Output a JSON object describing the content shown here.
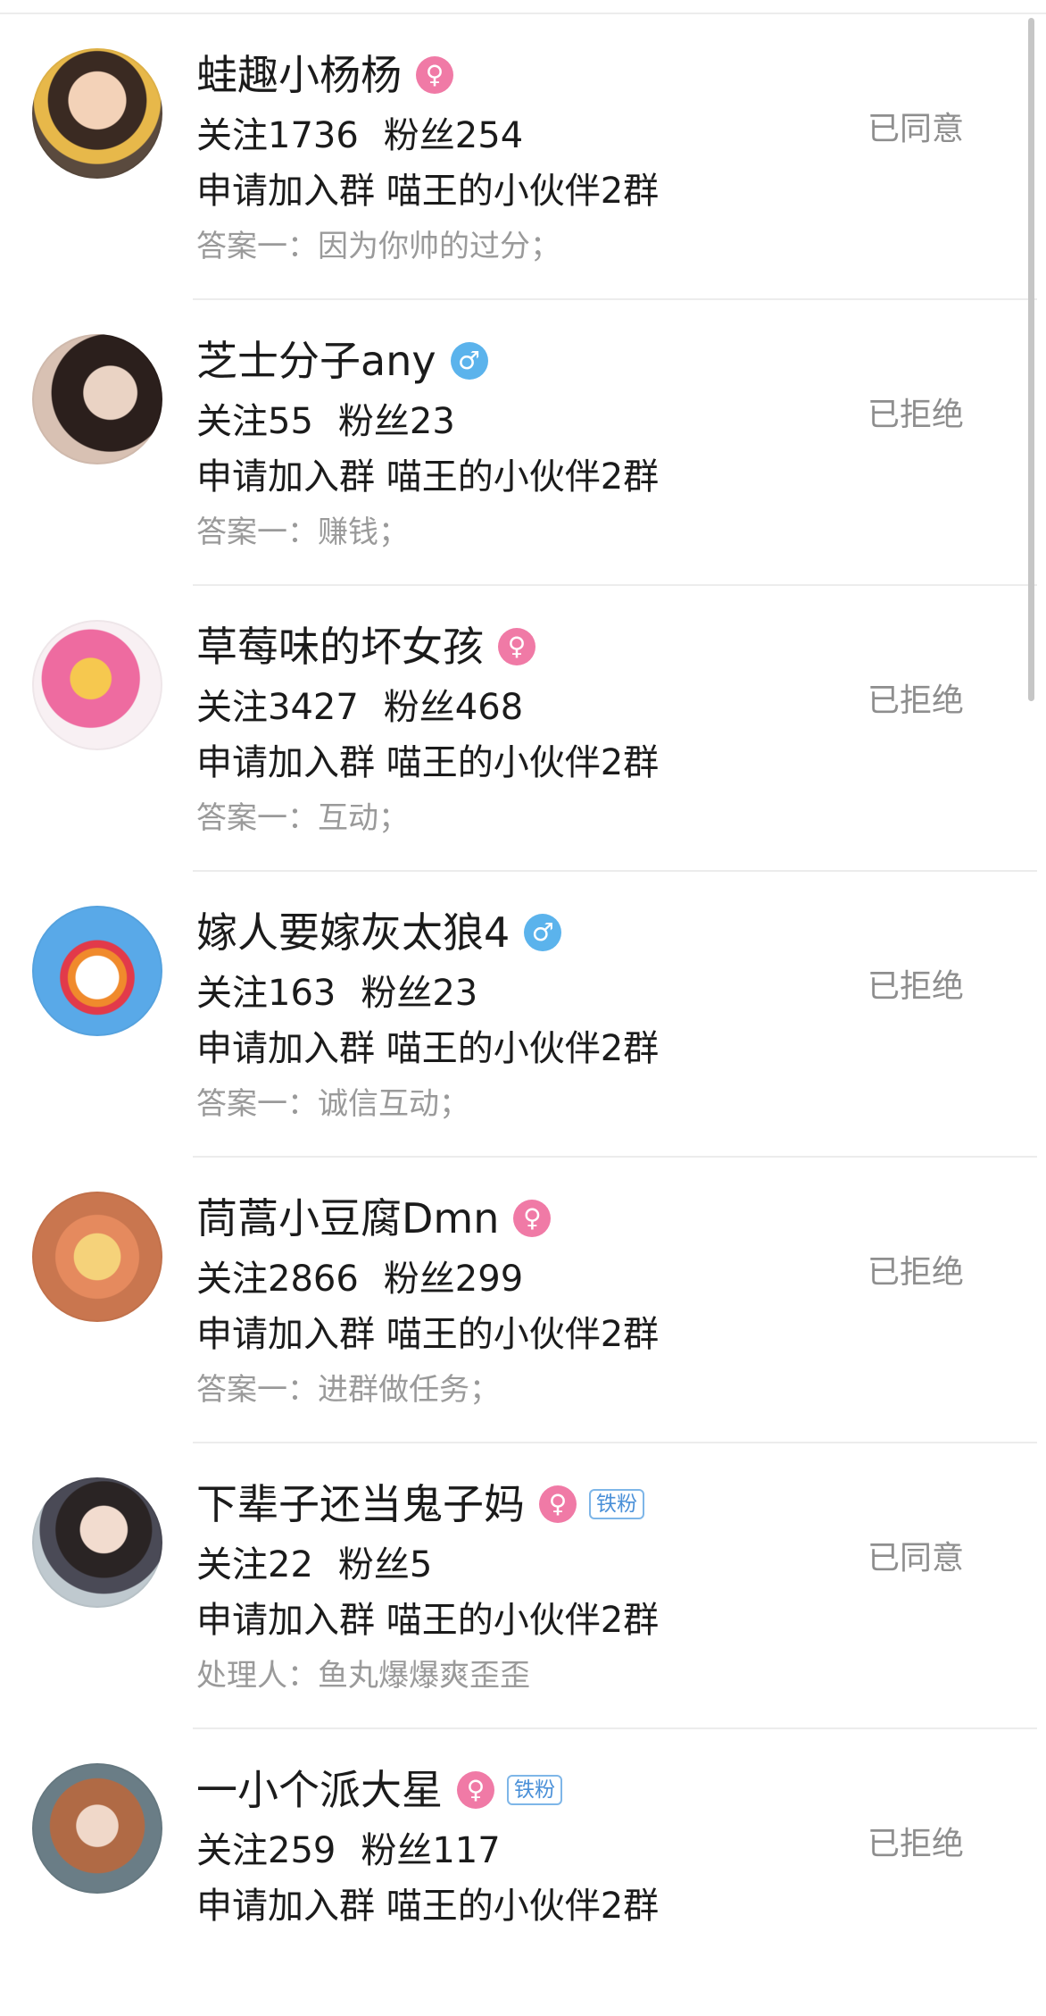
{
  "requests": [
    {
      "name": "蛙趣小杨杨",
      "gender": "female",
      "gender_icon": "female-icon",
      "tag": "",
      "follow": "关注1736",
      "fans": "粉丝254",
      "request": "申请加入群 喵王的小伙伴2群",
      "answer": "答案一：因为你帅的过分；",
      "status": "已同意"
    },
    {
      "name": "芝士分子any",
      "gender": "male",
      "gender_icon": "male-icon",
      "tag": "",
      "follow": "关注55",
      "fans": "粉丝23",
      "request": "申请加入群 喵王的小伙伴2群",
      "answer": "答案一：赚钱；",
      "status": "已拒绝"
    },
    {
      "name": "草莓味的坏女孩",
      "gender": "female",
      "gender_icon": "female-icon",
      "tag": "",
      "follow": "关注3427",
      "fans": "粉丝468",
      "request": "申请加入群 喵王的小伙伴2群",
      "answer": "答案一：互动；",
      "status": "已拒绝"
    },
    {
      "name": "嫁人要嫁灰太狼4",
      "gender": "male",
      "gender_icon": "male-icon",
      "tag": "",
      "follow": "关注163",
      "fans": "粉丝23",
      "request": "申请加入群 喵王的小伙伴2群",
      "answer": "答案一：诚信互动；",
      "status": "已拒绝"
    },
    {
      "name": "茼蒿小豆腐Dmn",
      "gender": "female",
      "gender_icon": "female-icon",
      "tag": "",
      "follow": "关注2866",
      "fans": "粉丝299",
      "request": "申请加入群 喵王的小伙伴2群",
      "answer": "答案一：进群做任务；",
      "status": "已拒绝"
    },
    {
      "name": "下辈子还当鬼子妈",
      "gender": "female",
      "gender_icon": "female-icon",
      "tag": "铁粉",
      "follow": "关注22",
      "fans": "粉丝5",
      "request": "申请加入群 喵王的小伙伴2群",
      "answer": "处理人：鱼丸爆爆爽歪歪",
      "status": "已同意"
    },
    {
      "name": "一小个派大星",
      "gender": "female",
      "gender_icon": "female-icon",
      "tag": "铁粉",
      "follow": "关注259",
      "fans": "粉丝117",
      "request": "申请加入群 喵王的小伙伴2群",
      "answer": "",
      "status": "已拒绝"
    }
  ],
  "colors": {
    "female": "#f07aa6",
    "male": "#5bb3ec",
    "tag": "#4a90d8"
  }
}
